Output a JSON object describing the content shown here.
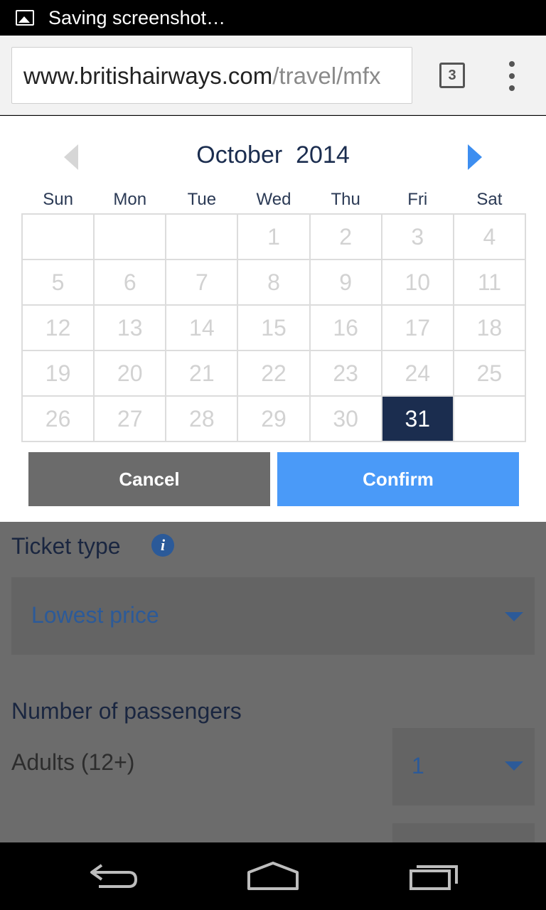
{
  "status_bar": {
    "icon": "image-icon",
    "text": "Saving screenshot…"
  },
  "browser": {
    "url_domain": "www.britishairways.com",
    "url_path": "/travel/mfx",
    "tab_count": "3",
    "menu_icon": "overflow-menu-icon"
  },
  "calendar": {
    "month": "October",
    "year": "2014",
    "title": "October  2014",
    "weekdays": [
      "Sun",
      "Mon",
      "Tue",
      "Wed",
      "Thu",
      "Fri",
      "Sat"
    ],
    "days": [
      "",
      "",
      "",
      "1",
      "2",
      "3",
      "4",
      "5",
      "6",
      "7",
      "8",
      "9",
      "10",
      "11",
      "12",
      "13",
      "14",
      "15",
      "16",
      "17",
      "18",
      "19",
      "20",
      "21",
      "22",
      "23",
      "24",
      "25",
      "26",
      "27",
      "28",
      "29",
      "30",
      "31",
      ""
    ],
    "selected_day": "31",
    "cancel_label": "Cancel",
    "confirm_label": "Confirm",
    "colors": {
      "selected": "#1b2d4f",
      "confirm": "#4a9af8",
      "cancel": "#6b6b6b"
    }
  },
  "form": {
    "ticket_type_label": "Ticket type",
    "ticket_type_value": "Lowest price",
    "passengers_label": "Number of passengers",
    "adults_label": "Adults (12+)",
    "adults_value": "1"
  },
  "nav": {
    "back_icon": "back-icon",
    "home_icon": "home-icon",
    "recents_icon": "recent-apps-icon"
  }
}
